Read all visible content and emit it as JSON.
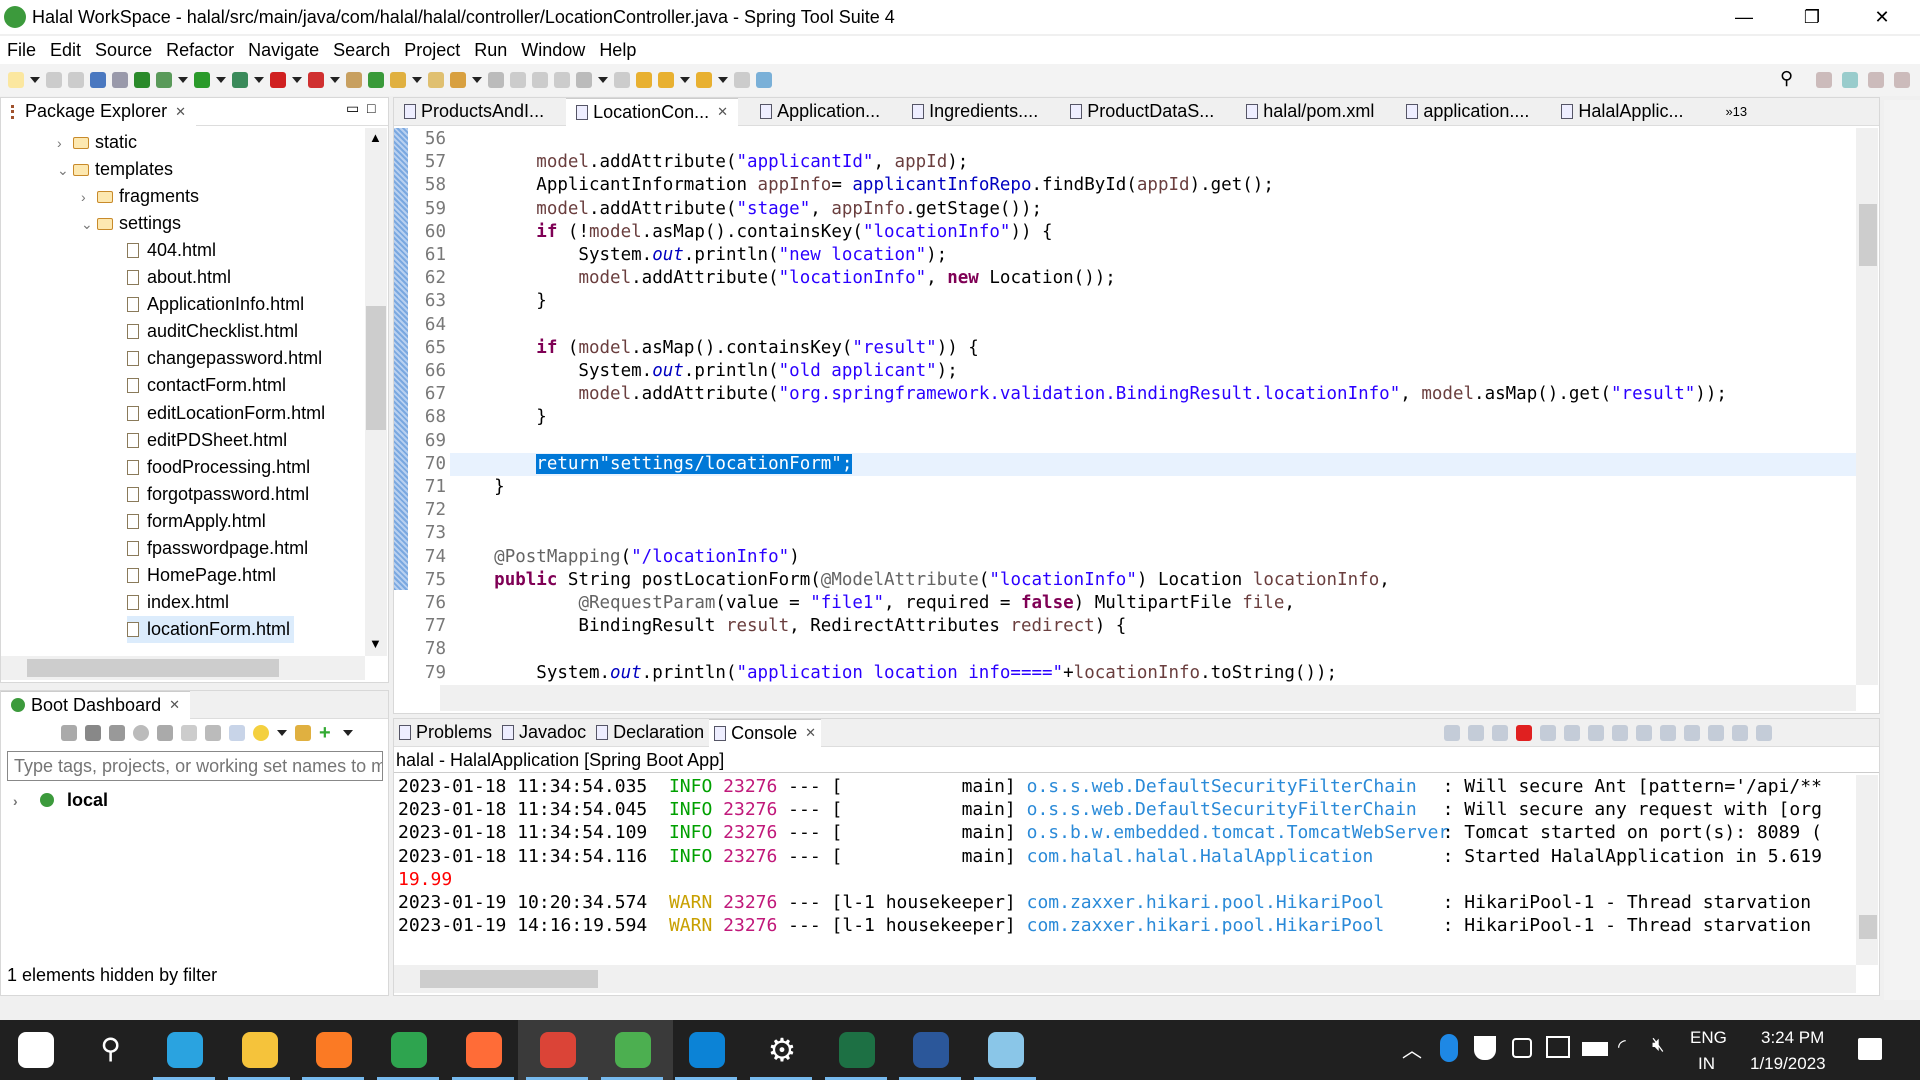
{
  "window": {
    "title": "Halal WorkSpace - halal/src/main/java/com/halal/halal/controller/LocationController.java - Spring Tool Suite 4",
    "minimize": "—",
    "maximize": "❐",
    "close": "✕"
  },
  "menu": [
    "File",
    "Edit",
    "Source",
    "Refactor",
    "Navigate",
    "Search",
    "Project",
    "Run",
    "Window",
    "Help"
  ],
  "package_explorer": {
    "title": "Package Explorer",
    "tree": [
      {
        "label": "static",
        "type": "folder",
        "level": 0,
        "state": "collapsed"
      },
      {
        "label": "templates",
        "type": "folder",
        "level": 0,
        "state": "expanded"
      },
      {
        "label": "fragments",
        "type": "folder",
        "level": 1,
        "state": "collapsed"
      },
      {
        "label": "settings",
        "type": "folder",
        "level": 1,
        "state": "expanded"
      },
      {
        "label": "404.html",
        "type": "file",
        "level": 2
      },
      {
        "label": "about.html",
        "type": "file",
        "level": 2
      },
      {
        "label": "ApplicationInfo.html",
        "type": "file",
        "level": 2
      },
      {
        "label": "auditChecklist.html",
        "type": "file",
        "level": 2
      },
      {
        "label": "changepassword.html",
        "type": "file",
        "level": 2
      },
      {
        "label": "contactForm.html",
        "type": "file",
        "level": 2
      },
      {
        "label": "editLocationForm.html",
        "type": "file",
        "level": 2
      },
      {
        "label": "editPDSheet.html",
        "type": "file",
        "level": 2
      },
      {
        "label": "foodProcessing.html",
        "type": "file",
        "level": 2
      },
      {
        "label": "forgotpassword.html",
        "type": "file",
        "level": 2
      },
      {
        "label": "formApply.html",
        "type": "file",
        "level": 2
      },
      {
        "label": "fpasswordpage.html",
        "type": "file",
        "level": 2
      },
      {
        "label": "HomePage.html",
        "type": "file",
        "level": 2
      },
      {
        "label": "index.html",
        "type": "file",
        "level": 2
      },
      {
        "label": "locationForm.html",
        "type": "file",
        "level": 2,
        "selected": true
      }
    ]
  },
  "boot_dashboard": {
    "title": "Boot Dashboard",
    "filter_placeholder": "Type tags, projects, or working set names to m",
    "items": [
      {
        "label": "local"
      }
    ],
    "status": "1 elements hidden by filter"
  },
  "editor": {
    "tabs": [
      {
        "label": "ProductsAndI..."
      },
      {
        "label": "LocationCon...",
        "active": true
      },
      {
        "label": "Application..."
      },
      {
        "label": "Ingredients...."
      },
      {
        "label": "ProductDataS..."
      },
      {
        "label": "halal/pom.xml"
      },
      {
        "label": "application...."
      },
      {
        "label": "HalalApplic..."
      }
    ],
    "overflow": "»13",
    "lines": [
      {
        "n": "56",
        "t": []
      },
      {
        "n": "57",
        "t": [
          [
            "p",
            "        "
          ],
          [
            "v",
            "model"
          ],
          [
            "p",
            ".addAttribute("
          ],
          [
            "s",
            "\"applicantId\""
          ],
          [
            "p",
            ", "
          ],
          [
            "v",
            "appId"
          ],
          [
            "p",
            ");"
          ]
        ]
      },
      {
        "n": "58",
        "t": [
          [
            "p",
            "        ApplicantInformation "
          ],
          [
            "v",
            "appInfo"
          ],
          [
            "p",
            "= "
          ],
          [
            "f",
            "applicantInfoRepo"
          ],
          [
            "p",
            ".findById("
          ],
          [
            "v",
            "appId"
          ],
          [
            "p",
            ").get();"
          ]
        ]
      },
      {
        "n": "59",
        "t": [
          [
            "p",
            "        "
          ],
          [
            "v",
            "model"
          ],
          [
            "p",
            ".addAttribute("
          ],
          [
            "s",
            "\"stage\""
          ],
          [
            "p",
            ", "
          ],
          [
            "v",
            "appInfo"
          ],
          [
            "p",
            ".getStage());"
          ]
        ]
      },
      {
        "n": "60",
        "t": [
          [
            "p",
            "        "
          ],
          [
            "k",
            "if"
          ],
          [
            "p",
            " (!"
          ],
          [
            "v",
            "model"
          ],
          [
            "p",
            ".asMap().containsKey("
          ],
          [
            "s",
            "\"locationInfo\""
          ],
          [
            "p",
            ")) {"
          ]
        ]
      },
      {
        "n": "61",
        "t": [
          [
            "p",
            "            System."
          ],
          [
            "o",
            "out"
          ],
          [
            "p",
            ".println("
          ],
          [
            "s",
            "\"new location\""
          ],
          [
            "p",
            ");"
          ]
        ]
      },
      {
        "n": "62",
        "t": [
          [
            "p",
            "            "
          ],
          [
            "v",
            "model"
          ],
          [
            "p",
            ".addAttribute("
          ],
          [
            "s",
            "\"locationInfo\""
          ],
          [
            "p",
            ", "
          ],
          [
            "k",
            "new"
          ],
          [
            "p",
            " Location());"
          ]
        ]
      },
      {
        "n": "63",
        "t": [
          [
            "p",
            "        }"
          ]
        ]
      },
      {
        "n": "64",
        "t": []
      },
      {
        "n": "65",
        "t": [
          [
            "p",
            "        "
          ],
          [
            "k",
            "if"
          ],
          [
            "p",
            " ("
          ],
          [
            "v",
            "model"
          ],
          [
            "p",
            ".asMap().containsKey("
          ],
          [
            "s",
            "\"result\""
          ],
          [
            "p",
            ")) {"
          ]
        ]
      },
      {
        "n": "66",
        "t": [
          [
            "p",
            "            System."
          ],
          [
            "o",
            "out"
          ],
          [
            "p",
            ".println("
          ],
          [
            "s",
            "\"old applicant\""
          ],
          [
            "p",
            ");"
          ]
        ]
      },
      {
        "n": "67",
        "t": [
          [
            "p",
            "            "
          ],
          [
            "v",
            "model"
          ],
          [
            "p",
            ".addAttribute("
          ],
          [
            "s",
            "\"org.springframework.validation.BindingResult.locationInfo\""
          ],
          [
            "p",
            ", "
          ],
          [
            "v",
            "model"
          ],
          [
            "p",
            ".asMap().get("
          ],
          [
            "s",
            "\"result\""
          ],
          [
            "p",
            "));"
          ]
        ]
      },
      {
        "n": "68",
        "t": [
          [
            "p",
            "        }"
          ]
        ]
      },
      {
        "n": "69",
        "t": []
      },
      {
        "n": "70",
        "current": true,
        "t": [
          [
            "p",
            "        "
          ],
          [
            "sel",
            "return\"settings/locationForm\";"
          ]
        ]
      },
      {
        "n": "71",
        "t": [
          [
            "p",
            "    }"
          ]
        ]
      },
      {
        "n": "72",
        "t": []
      },
      {
        "n": "73",
        "t": []
      },
      {
        "n": "74",
        "t": [
          [
            "p",
            "    "
          ],
          [
            "a",
            "@PostMapping"
          ],
          [
            "p",
            "("
          ],
          [
            "s",
            "\"/locationInfo\""
          ],
          [
            "p",
            ")"
          ]
        ]
      },
      {
        "n": "75",
        "t": [
          [
            "p",
            "    "
          ],
          [
            "k",
            "public"
          ],
          [
            "p",
            " String postLocationForm("
          ],
          [
            "a",
            "@ModelAttribute"
          ],
          [
            "p",
            "("
          ],
          [
            "s",
            "\"locationInfo\""
          ],
          [
            "p",
            ") Location "
          ],
          [
            "v",
            "locationInfo"
          ],
          [
            "p",
            ","
          ]
        ]
      },
      {
        "n": "76",
        "t": [
          [
            "p",
            "            "
          ],
          [
            "a",
            "@RequestParam"
          ],
          [
            "p",
            "(value = "
          ],
          [
            "s",
            "\"file1\""
          ],
          [
            "p",
            ", required = "
          ],
          [
            "k",
            "false"
          ],
          [
            "p",
            ") MultipartFile "
          ],
          [
            "v",
            "file"
          ],
          [
            "p",
            ","
          ]
        ]
      },
      {
        "n": "77",
        "t": [
          [
            "p",
            "            BindingResult "
          ],
          [
            "v",
            "result"
          ],
          [
            "p",
            ", RedirectAttributes "
          ],
          [
            "v",
            "redirect"
          ],
          [
            "p",
            ") {"
          ]
        ]
      },
      {
        "n": "78",
        "t": []
      },
      {
        "n": "79",
        "t": [
          [
            "p",
            "        System."
          ],
          [
            "o",
            "out"
          ],
          [
            "p",
            ".println("
          ],
          [
            "s",
            "\"application location info====\""
          ],
          [
            "p",
            "+"
          ],
          [
            "v",
            "locationInfo"
          ],
          [
            "p",
            ".toString());"
          ]
        ]
      }
    ]
  },
  "console": {
    "tabs": [
      {
        "label": "Problems"
      },
      {
        "label": "Javadoc"
      },
      {
        "label": "Declaration"
      },
      {
        "label": "Console",
        "active": true
      }
    ],
    "header": "halal - HalalApplication [Spring Boot App]",
    "lines": [
      {
        "ts": "2023-01-18 11:34:54.035",
        "level": "INFO",
        "pid": "23276",
        "sep": "---",
        "thread": "[           main]",
        "logger": "o.s.s.web.DefaultSecurityFilterChain",
        "msg": ": Will secure Ant [pattern='/api/**"
      },
      {
        "ts": "2023-01-18 11:34:54.045",
        "level": "INFO",
        "pid": "23276",
        "sep": "---",
        "thread": "[           main]",
        "logger": "o.s.s.web.DefaultSecurityFilterChain",
        "msg": ": Will secure any request with [org"
      },
      {
        "ts": "2023-01-18 11:34:54.109",
        "level": "INFO",
        "pid": "23276",
        "sep": "---",
        "thread": "[           main]",
        "logger": "o.s.b.w.embedded.tomcat.TomcatWebServer",
        "msg": ": Tomcat started on port(s): 8089 ("
      },
      {
        "ts": "2023-01-18 11:34:54.116",
        "level": "INFO",
        "pid": "23276",
        "sep": "---",
        "thread": "[           main]",
        "logger": "com.halal.halal.HalalApplication",
        "msg": ": Started HalalApplication in 5.619"
      },
      {
        "plain": "19.99"
      },
      {
        "ts": "2023-01-19 10:20:34.574",
        "level": "WARN",
        "pid": "23276",
        "sep": "---",
        "thread": "[l-1 housekeeper]",
        "logger": "com.zaxxer.hikari.pool.HikariPool",
        "msg": ": HikariPool-1 - Thread starvation"
      },
      {
        "ts": "2023-01-19 14:16:19.594",
        "level": "WARN",
        "pid": "23276",
        "sep": "---",
        "thread": "[l-1 housekeeper]",
        "logger": "com.zaxxer.hikari.pool.HikariPool",
        "msg": ": HikariPool-1 - Thread starvation"
      }
    ]
  },
  "colors": {
    "info": "#00a000",
    "warn": "#c8a000",
    "pid": "#c0187a",
    "logger": "#2a8ad8",
    "error": "#ff0000",
    "selection": "#0078d7"
  },
  "taskbar": {
    "apps": [
      "start",
      "search",
      "telegram",
      "file-explorer",
      "xampp",
      "hs",
      "postman",
      "chrome",
      "spring-tool-suite",
      "edge",
      "settings",
      "excel",
      "word",
      "notepad"
    ],
    "lang": "ENG",
    "region": "IN",
    "time": "3:24 PM",
    "date": "1/19/2023"
  }
}
